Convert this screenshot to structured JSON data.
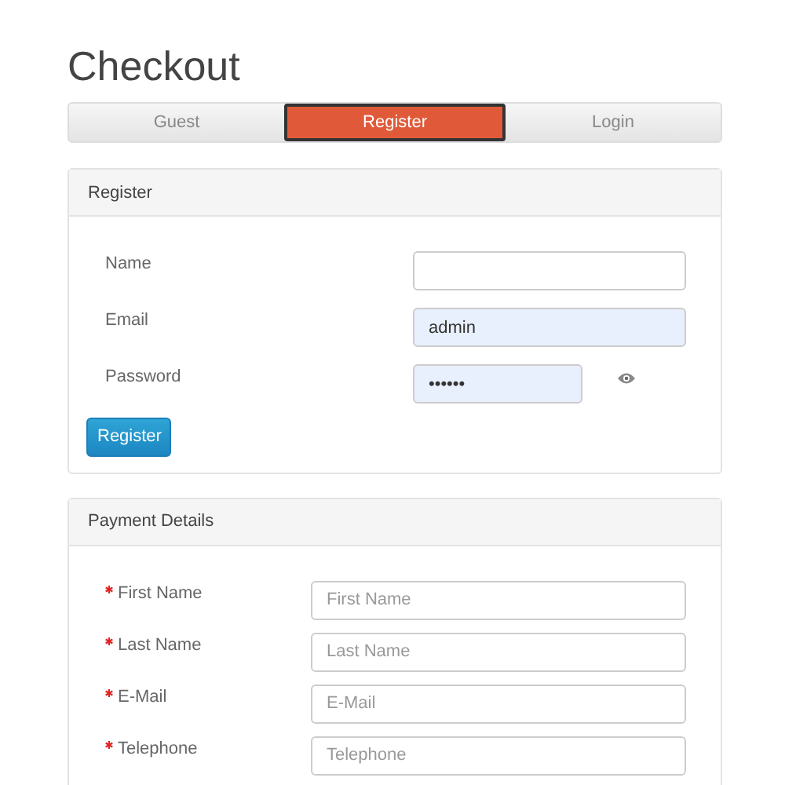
{
  "title": "Checkout",
  "tabs": [
    {
      "label": "Guest",
      "selected": false
    },
    {
      "label": "Register",
      "selected": true
    },
    {
      "label": "Login",
      "selected": false
    }
  ],
  "register_panel": {
    "heading": "Register",
    "fields": [
      {
        "label": "Name",
        "kind": "text",
        "autofilled": false
      },
      {
        "label": "Email",
        "kind": "text",
        "value": "admin",
        "autofilled": true
      },
      {
        "label": "Password",
        "kind": "password",
        "value": "••••••",
        "autofilled": true
      }
    ],
    "button": "Register"
  },
  "payment_panel": {
    "heading": "Payment Details",
    "fields": [
      {
        "label": "First Name",
        "required": true,
        "placeholder": "First Name"
      },
      {
        "label": "Last Name",
        "required": true,
        "placeholder": "Last Name"
      },
      {
        "label": "E-Mail",
        "required": true,
        "placeholder": "E-Mail"
      },
      {
        "label": "Telephone",
        "required": true,
        "placeholder": "Telephone"
      }
    ]
  }
}
